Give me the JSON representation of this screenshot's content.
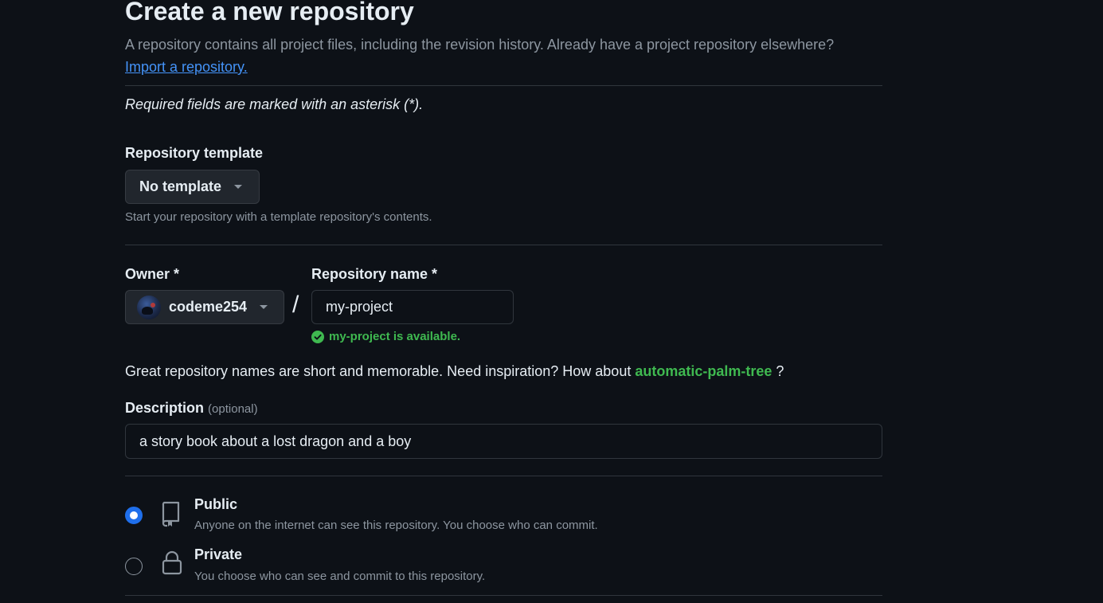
{
  "header": {
    "title": "Create a new repository",
    "intro": "A repository contains all project files, including the revision history. Already have a project repository elsewhere?",
    "import_link": "Import a repository."
  },
  "required_note": "Required fields are marked with an asterisk (*).",
  "template": {
    "label": "Repository template",
    "value": "No template",
    "hint": "Start your repository with a template repository's contents."
  },
  "owner": {
    "label": "Owner *",
    "value": "codeme254"
  },
  "repo_name": {
    "label": "Repository name *",
    "value": "my-project",
    "availability": "my-project is available."
  },
  "suggestion": {
    "text": "Great repository names are short and memorable. Need inspiration? How about",
    "name": "automatic-palm-tree",
    "suffix": "?"
  },
  "description": {
    "label": "Description",
    "optional": "(optional)",
    "value": "a story book about a lost dragon and a boy"
  },
  "visibility": {
    "selected": "Public",
    "options": [
      {
        "title": "Public",
        "desc": "Anyone on the internet can see this repository. You choose who can commit.",
        "icon": "repo-icon"
      },
      {
        "title": "Private",
        "desc": "You choose who can see and commit to this repository.",
        "icon": "lock-icon"
      }
    ]
  },
  "colors": {
    "background": "#0d1117",
    "accent_blue": "#1f6feb",
    "link_blue": "#4493f8",
    "success_green": "#3fb950",
    "muted": "#8d96a0"
  }
}
